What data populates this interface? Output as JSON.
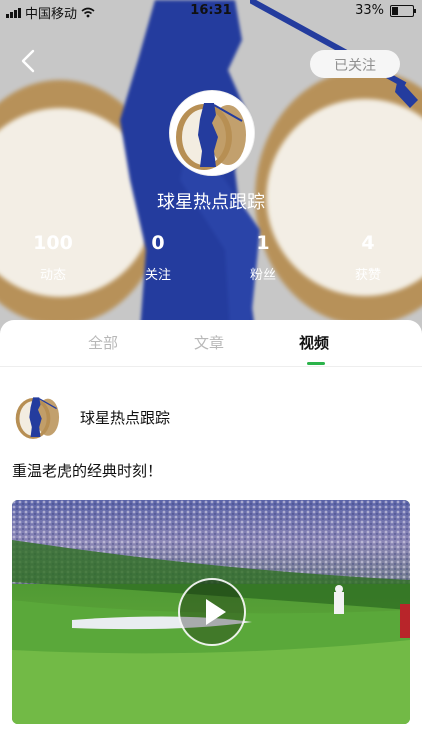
{
  "status_bar": {
    "carrier": "中国移动",
    "time": "16:31",
    "battery": "33%"
  },
  "profile": {
    "follow_button": "已关注",
    "name": "球星热点跟踪",
    "stats": [
      {
        "value": "100",
        "label": "动态"
      },
      {
        "value": "0",
        "label": "关注"
      },
      {
        "value": "1",
        "label": "粉丝"
      },
      {
        "value": "4",
        "label": "获赞"
      }
    ]
  },
  "tabs": [
    {
      "label": "全部",
      "active": false
    },
    {
      "label": "文章",
      "active": false
    },
    {
      "label": "视频",
      "active": true
    }
  ],
  "post": {
    "author": "球星热点跟踪",
    "text": "重温老虎的经典时刻！"
  },
  "colors": {
    "accent": "#2bb34a",
    "golfer_blue": "#243c9e",
    "ball_gold": "#b78f54"
  },
  "icons": [
    "back-icon",
    "play-icon",
    "wifi-icon",
    "battery-icon",
    "signal-icon"
  ]
}
